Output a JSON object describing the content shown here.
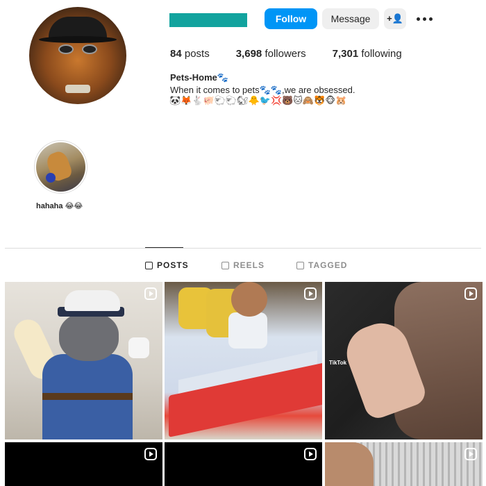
{
  "profile": {
    "stats": {
      "posts": "84",
      "posts_label": "posts",
      "followers": "3,698",
      "followers_label": "followers",
      "following": "7,301",
      "following_label": "following"
    },
    "bio": {
      "name": "Pets-Home🐾",
      "line": "When it comes to pets🐾🐾,we are obsessed.",
      "emojis": "🐼🦊🐇🐖🐑🐑🐿🐥🐦💢🐻🐱🙈🐯🐵🐹"
    }
  },
  "actions": {
    "follow_label": "Follow",
    "message_label": "Message",
    "suggest_label": "+👤"
  },
  "highlights": [
    {
      "label": "hahaha 😂😂"
    }
  ],
  "tabs": [
    {
      "label": "POSTS",
      "active": true
    },
    {
      "label": "REELS",
      "active": false
    },
    {
      "label": "TAGGED",
      "active": false
    }
  ],
  "posts": [
    {
      "tile": 1,
      "type": "reel"
    },
    {
      "tile": 2,
      "type": "reel"
    },
    {
      "tile": 3,
      "type": "reel",
      "overlay": "TikTok"
    },
    {
      "tile": 4,
      "type": "reel"
    },
    {
      "tile": 5,
      "type": "reel"
    },
    {
      "tile": 6,
      "type": "reel"
    }
  ],
  "colors": {
    "accent": "#0095f6",
    "username_redaction": "#12a39e"
  }
}
